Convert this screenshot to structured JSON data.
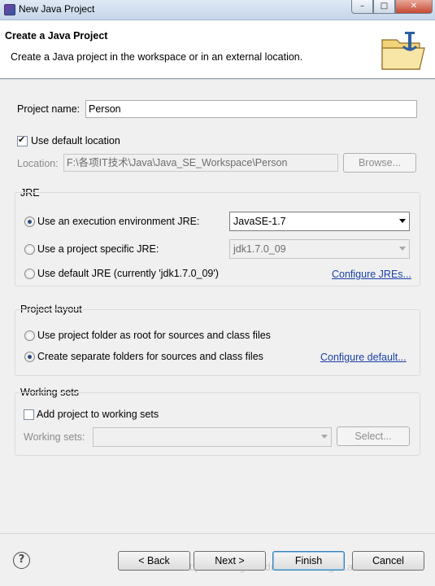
{
  "window": {
    "title": "New Java Project",
    "min_glyph": "–",
    "max_glyph": "□",
    "close_glyph": "✕"
  },
  "header": {
    "title": "Create a Java Project",
    "description": "Create a Java project in the workspace or in an external location.",
    "icon": "java-project-folder-icon"
  },
  "project": {
    "name_label": "Project name:",
    "name_value": "Person",
    "use_default_location_label": "Use default location",
    "use_default_location_checked": true,
    "location_label": "Location:",
    "location_value": "F:\\各项IT技术\\Java\\Java_SE_Workspace\\Person",
    "browse_label": "Browse..."
  },
  "jre": {
    "group_label": "JRE",
    "options": [
      {
        "label": "Use an execution environment JRE:",
        "selected": true
      },
      {
        "label": "Use a project specific JRE:",
        "selected": false
      },
      {
        "label": "Use default JRE (currently 'jdk1.7.0_09')",
        "selected": false
      }
    ],
    "env_value": "JavaSE-1.7",
    "specific_value": "jdk1.7.0_09",
    "configure_link": "Configure JREs..."
  },
  "layout": {
    "group_label": "Project layout",
    "options": [
      {
        "label": "Use project folder as root for sources and class files",
        "selected": false
      },
      {
        "label": "Create separate folders for sources and class files",
        "selected": true
      }
    ],
    "configure_link": "Configure default..."
  },
  "working_sets": {
    "group_label": "Working sets",
    "add_label": "Add project to working sets",
    "add_checked": false,
    "sets_label": "Working sets:",
    "sets_value": "",
    "select_label": "Select..."
  },
  "footer": {
    "help_glyph": "?",
    "back_label": "< Back",
    "next_label": "Next >",
    "finish_label": "Finish",
    "cancel_label": "Cancel",
    "watermark": "http://blog.csdn.net/wangxiaosu"
  }
}
